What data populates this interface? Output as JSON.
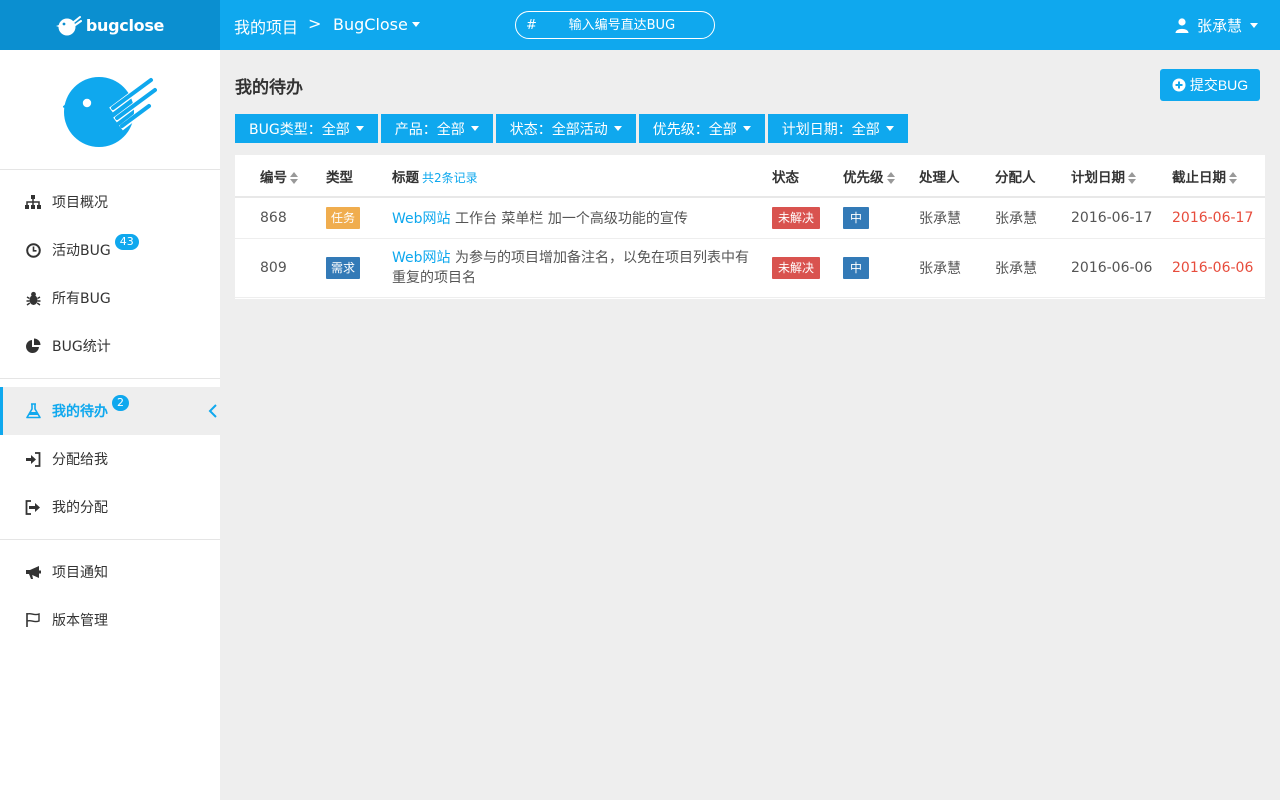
{
  "brand": {
    "name": "bugclose"
  },
  "header": {
    "breadcrumb_root": "我的项目",
    "breadcrumb_sep": ">",
    "project": "BugClose",
    "search_hash": "#",
    "search_placeholder": "输入编号直达BUG",
    "user": "张承慧"
  },
  "sidebar": {
    "groups": [
      [
        {
          "label": "项目概况",
          "icon": "sitemap-icon"
        },
        {
          "label": "活动BUG",
          "icon": "clock-icon",
          "badge": "43"
        },
        {
          "label": "所有BUG",
          "icon": "bug-icon"
        },
        {
          "label": "BUG统计",
          "icon": "pie-chart-icon"
        }
      ],
      [
        {
          "label": "我的待办",
          "icon": "flask-icon",
          "badge": "2",
          "active": true
        },
        {
          "label": "分配给我",
          "icon": "sign-in-icon"
        },
        {
          "label": "我的分配",
          "icon": "sign-out-icon"
        }
      ],
      [
        {
          "label": "项目通知",
          "icon": "bullhorn-icon"
        },
        {
          "label": "版本管理",
          "icon": "flag-icon"
        }
      ]
    ]
  },
  "main": {
    "title": "我的待办",
    "submit_label": "提交BUG",
    "filters": [
      "BUG类型：全部",
      "产品：全部",
      "状态：全部活动",
      "优先级：全部",
      "计划日期：全部"
    ],
    "table": {
      "headers": {
        "id": "编号",
        "type": "类型",
        "title": "标题",
        "count": "共2条记录",
        "state": "状态",
        "priority": "优先级",
        "handler": "处理人",
        "assigner": "分配人",
        "plan_date": "计划日期",
        "due_date": "截止日期"
      },
      "rows": [
        {
          "id": "868",
          "type": "任务",
          "product": "Web网站",
          "title": "工作台 菜单栏 加一个高级功能的宣传",
          "state": "未解决",
          "priority": "中",
          "handler": "张承慧",
          "assigner": "张承慧",
          "plan_date": "2016-06-17",
          "due_date": "2016-06-17"
        },
        {
          "id": "809",
          "type": "需求",
          "product": "Web网站",
          "title_line1": "为参与的项目增加备注名，以免在项目列表中有",
          "title_line2": "重复的项目名",
          "state": "未解决",
          "priority": "中",
          "handler": "张承慧",
          "assigner": "张承慧",
          "plan_date": "2016-06-06",
          "due_date": "2016-06-06"
        }
      ]
    }
  },
  "colors": {
    "primary": "#0fa8ee",
    "brand_dark": "#0b8fd0",
    "danger": "#d9534f",
    "warning": "#f0ad4e",
    "info": "#337ab7",
    "overdue": "#e74c3c"
  }
}
